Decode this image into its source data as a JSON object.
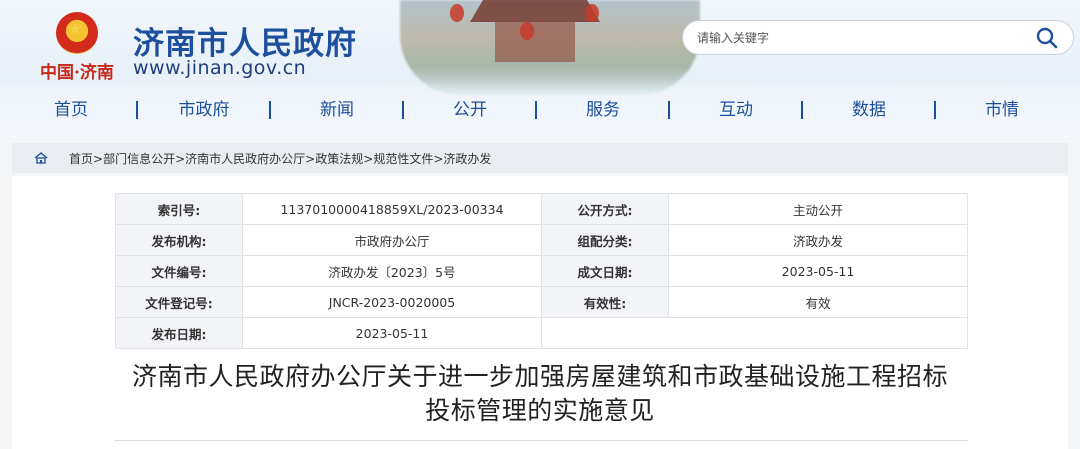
{
  "header": {
    "logo_tag": "中国·济南",
    "site_name": "济南市人民政府",
    "site_url": "www.jinan.gov.cn",
    "search_placeholder": "请输入关键字"
  },
  "nav": {
    "items": [
      "首页",
      "市政府",
      "新闻",
      "公开",
      "服务",
      "互动",
      "数据",
      "市情"
    ],
    "separator": "|"
  },
  "breadcrumb": {
    "items": [
      "首页",
      "部门信息公开",
      "济南市人民政府办公厅",
      "政策法规",
      "规范性文件",
      "济政办发"
    ],
    "separator": ">"
  },
  "meta_table": {
    "rows": [
      [
        {
          "label": "索引号:",
          "value": "113701000041885​9XL/2023-00334"
        },
        {
          "label": "公开方式:",
          "value": "主动公开"
        }
      ],
      [
        {
          "label": "发布机构:",
          "value": "市政府办公厅"
        },
        {
          "label": "组配分类:",
          "value": "济政办发"
        }
      ],
      [
        {
          "label": "文件编号:",
          "value": "济政办发〔2023〕5号"
        },
        {
          "label": "成文日期:",
          "value": "2023-05-11"
        }
      ],
      [
        {
          "label": "文件登记号:",
          "value": "JNCR-2023-0020005"
        },
        {
          "label": "有效性:",
          "value": "有效"
        }
      ],
      [
        {
          "label": "发布日期:",
          "value": "2023-05-11"
        },
        {
          "label": "",
          "value": ""
        }
      ]
    ]
  },
  "document": {
    "title_line1": "济南市人民政府办公厅关于进一步加强房屋建筑和市政基础设施工程招标",
    "title_line2": "投标管理的实施意见"
  },
  "colors": {
    "brand_blue": "#1c4f9c",
    "brand_red": "#c62a1a"
  }
}
